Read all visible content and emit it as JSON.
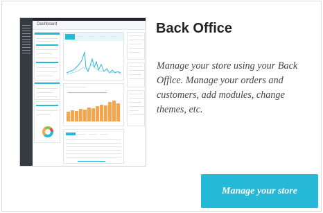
{
  "card": {
    "title": "Back Office",
    "description": "Manage your store using your Back Office. Manage your orders and customers, add modules, change themes, etc.",
    "button_label": "Manage your store"
  },
  "screenshot": {
    "header_title": "Dashboard"
  },
  "colors": {
    "accent": "#25b9d7",
    "chart_bars": "#f5a54a",
    "sidebar": "#363a41"
  }
}
